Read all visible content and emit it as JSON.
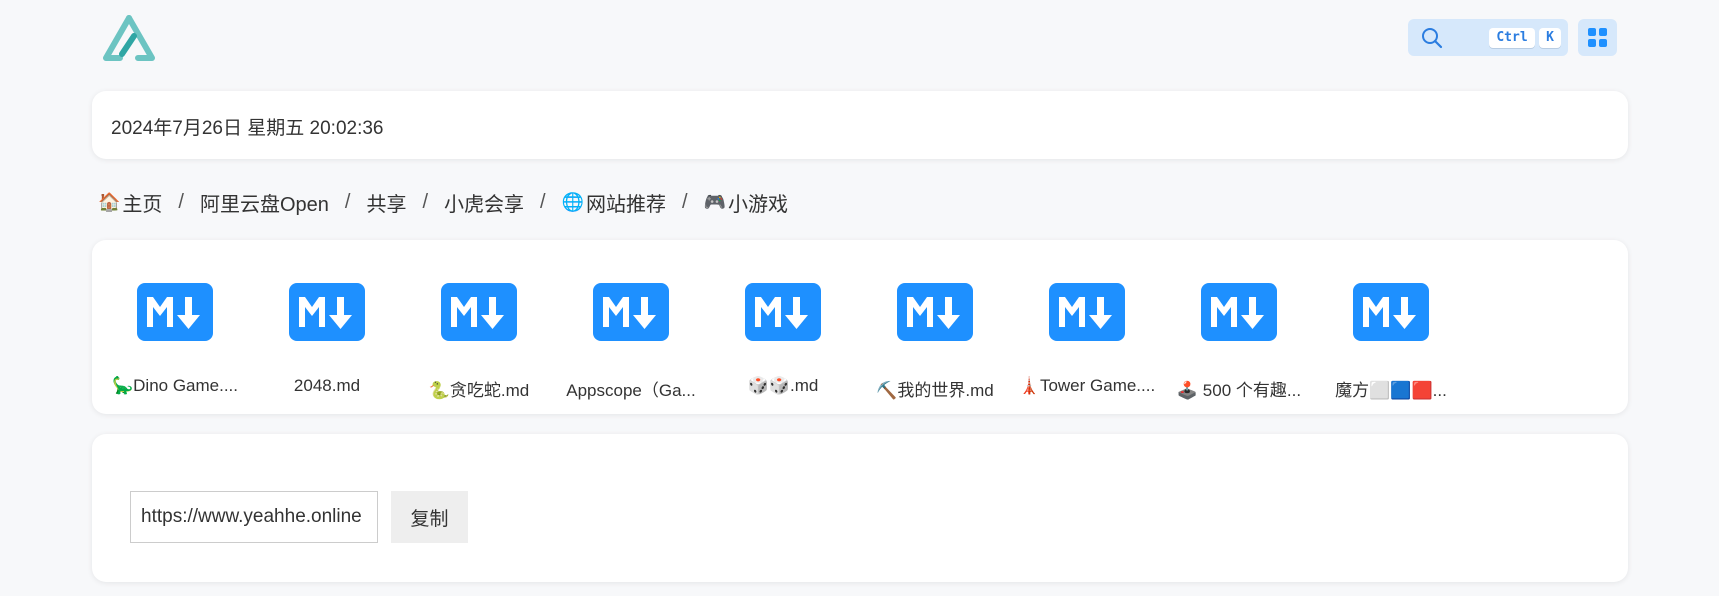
{
  "header": {
    "logo_alt": "logo",
    "search": {
      "kbd_ctrl": "Ctrl",
      "kbd_k": "K"
    },
    "accent_color": "#1e90ff"
  },
  "datetime": "2024年7月26日 星期五 20:02:36",
  "breadcrumb": [
    {
      "icon": "🏠",
      "label": "主页"
    },
    {
      "icon": "",
      "label": "阿里云盘Open"
    },
    {
      "icon": "",
      "label": "共享"
    },
    {
      "icon": "",
      "label": "小虎会享"
    },
    {
      "icon": "🌐",
      "label": "网站推荐"
    },
    {
      "icon": "🎮",
      "label": "小游戏"
    }
  ],
  "breadcrumb_separator": "/",
  "files": [
    {
      "name": "🦕Dino Game....",
      "icon": "markdown-icon"
    },
    {
      "name": "2048.md",
      "icon": "markdown-icon"
    },
    {
      "name": "🐍贪吃蛇.md",
      "icon": "markdown-icon"
    },
    {
      "name": "Appscope（Ga...",
      "icon": "markdown-icon"
    },
    {
      "name": "🎲🎲.md",
      "icon": "markdown-icon"
    },
    {
      "name": "⛏️我的世界.md",
      "icon": "markdown-icon"
    },
    {
      "name": "🗼Tower Game....",
      "icon": "markdown-icon"
    },
    {
      "name": "🕹️ 500 个有趣...",
      "icon": "markdown-icon"
    },
    {
      "name": "魔方⬜🟦🟥...",
      "icon": "markdown-icon"
    }
  ],
  "link": {
    "url": "https://www.yeahhe.online",
    "copy_label": "复制"
  }
}
